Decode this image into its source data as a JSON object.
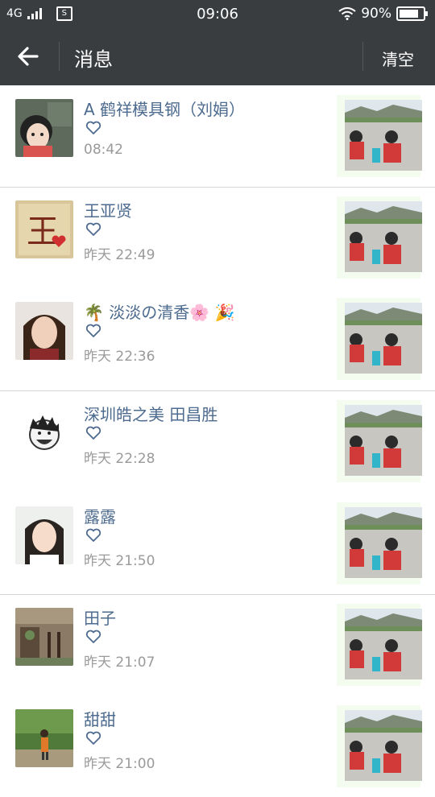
{
  "status_bar": {
    "network": "4G",
    "sim_label": "S",
    "time": "09:06",
    "battery": "90%",
    "battery_level": 0.9
  },
  "header": {
    "back_icon": "arrow-left-icon",
    "title": "消息",
    "clear_label": "清空"
  },
  "messages": [
    {
      "name": "A 鹤祥模具钢（刘娟）",
      "icon": "heart-icon",
      "time": "08:42"
    },
    {
      "name": "王亚贤",
      "icon": "heart-icon",
      "time": "昨天 22:49"
    },
    {
      "name": "🌴 淡淡の清香🌸 🎉",
      "icon": "heart-icon",
      "time": "昨天 22:36"
    },
    {
      "name": "深圳皓之美  田昌胜",
      "icon": "heart-icon",
      "time": "昨天 22:28"
    },
    {
      "name": "露露",
      "icon": "heart-icon",
      "time": "昨天 21:50"
    },
    {
      "name": "田子",
      "icon": "heart-icon",
      "time": "昨天 21:07"
    },
    {
      "name": "甜甜",
      "icon": "heart-icon",
      "time": "昨天 21:00"
    }
  ],
  "colors": {
    "header_bg": "#3a3d40",
    "name_text": "#4d6b8f",
    "time_text": "#9a9a9a",
    "divider": "#d8d8d8"
  }
}
